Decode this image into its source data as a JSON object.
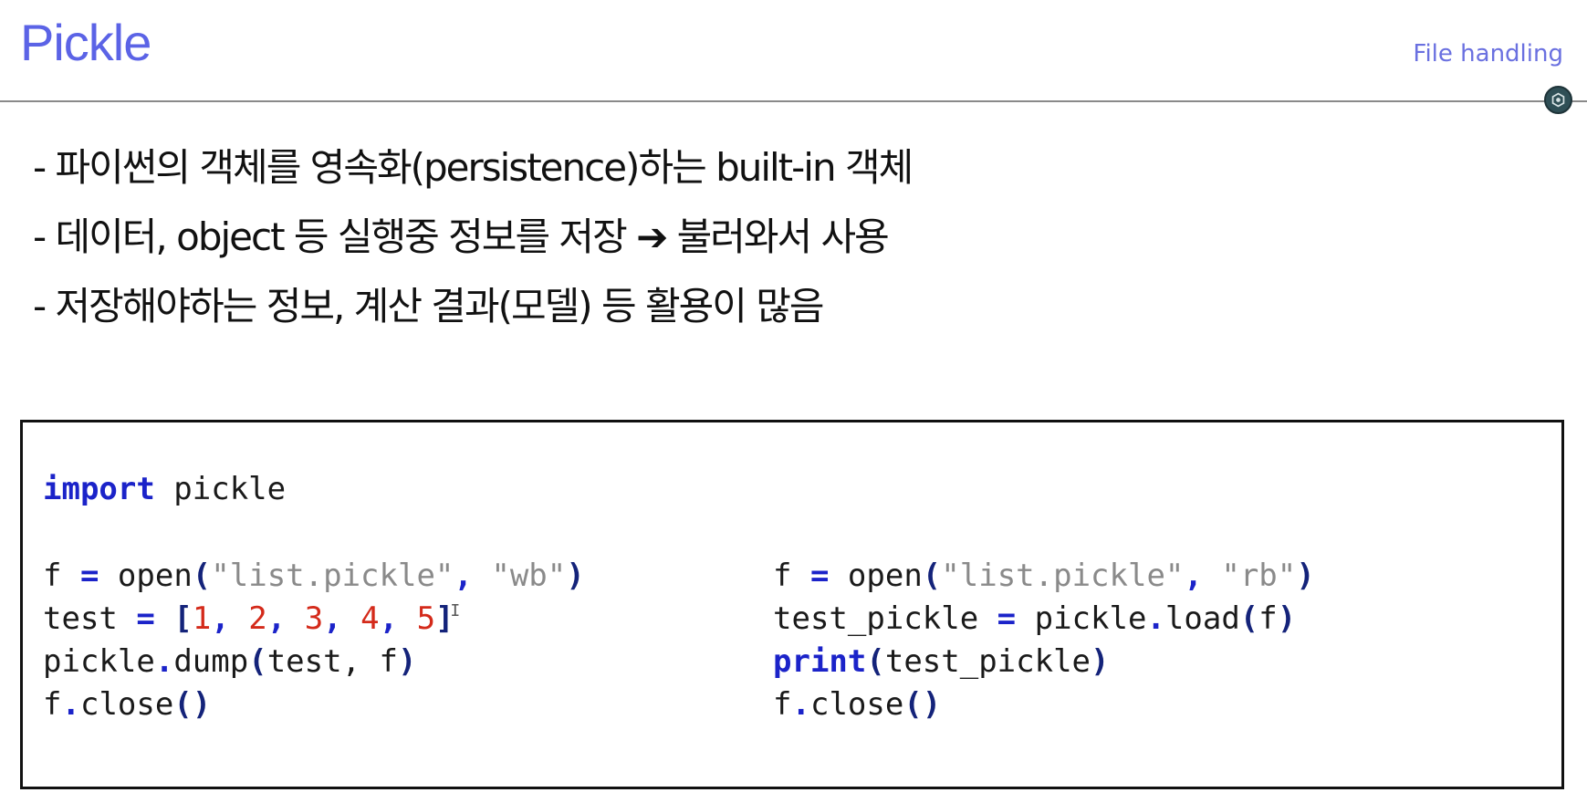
{
  "header": {
    "title": "Pickle",
    "section": "File handling"
  },
  "bullets": [
    "- 파이썬의 객체를 영속화(persistence)하는 built-in 객체",
    "- 데이터, object 등 실행중 정보를 저장 ➔ 불러와서 사용",
    "- 저장해야하는 정보, 계산 결과(모델) 등 활용이 많음"
  ],
  "code": {
    "import_kw": "import",
    "import_mod": " pickle",
    "left": {
      "l1_a": "f ",
      "l1_eq": "=",
      "l1_b": " open",
      "l1_p1": "(",
      "l1_s1": "\"list.pickle\"",
      "l1_c": ", ",
      "l1_s2": "\"wb\"",
      "l1_p2": ")",
      "l2_a": "test ",
      "l2_eq": "=",
      "l2_sp": " ",
      "l2_b1": "[",
      "l2_n1": "1",
      "l2_n2": "2",
      "l2_n3": "3",
      "l2_n4": "4",
      "l2_n5": "5",
      "l2_comma": ", ",
      "l2_b2": "]",
      "l3_a": "pickle",
      "l3_dot": ".",
      "l3_b": "dump",
      "l3_p1": "(",
      "l3_c": "test, f",
      "l3_p2": ")",
      "l4_a": "f",
      "l4_dot": ".",
      "l4_b": "close",
      "l4_p": "()"
    },
    "right": {
      "l1_a": "f ",
      "l1_eq": "=",
      "l1_b": " open",
      "l1_p1": "(",
      "l1_s1": "\"list.pickle\"",
      "l1_c": ", ",
      "l1_s2": "\"rb\"",
      "l1_p2": ")",
      "l2_a": "test_pickle ",
      "l2_eq": "=",
      "l2_b": " pickle",
      "l2_dot": ".",
      "l2_c": "load",
      "l2_p1": "(",
      "l2_d": "f",
      "l2_p2": ")",
      "l3_kw": "print",
      "l3_p1": "(",
      "l3_a": "test_pickle",
      "l3_p2": ")",
      "l4_a": "f",
      "l4_dot": ".",
      "l4_b": "close",
      "l4_p": "()"
    }
  },
  "colors": {
    "title": "#5b63e6",
    "keyword": "#1b23c9",
    "string": "#8a8a8a",
    "number": "#d42a1a",
    "paren": "#14237a"
  }
}
